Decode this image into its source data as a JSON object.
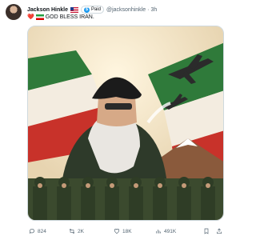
{
  "tweet": {
    "author_name": "Jackson Hinkle",
    "author_flag": "us-flag",
    "badge_label": "Paid",
    "handle": "@jacksonhinkle",
    "separator": "·",
    "time": "3h",
    "text_emoji_heart": "❤️",
    "text_flag": "iran-flag",
    "text": "GOD BLESS IRAN."
  },
  "media": {
    "description_icon": "illustrated-poster",
    "colors": {
      "green": "#2f7a3a",
      "red": "#c8322a",
      "cream": "#efe6cf",
      "sky": "#e9dcc4"
    }
  },
  "actions": {
    "reply_count": "824",
    "retweet_count": "2K",
    "like_count": "18K",
    "views_count": "491K"
  },
  "colors": {
    "text": "#0f1419",
    "muted": "#536471",
    "accent": "#1d9bf0"
  }
}
